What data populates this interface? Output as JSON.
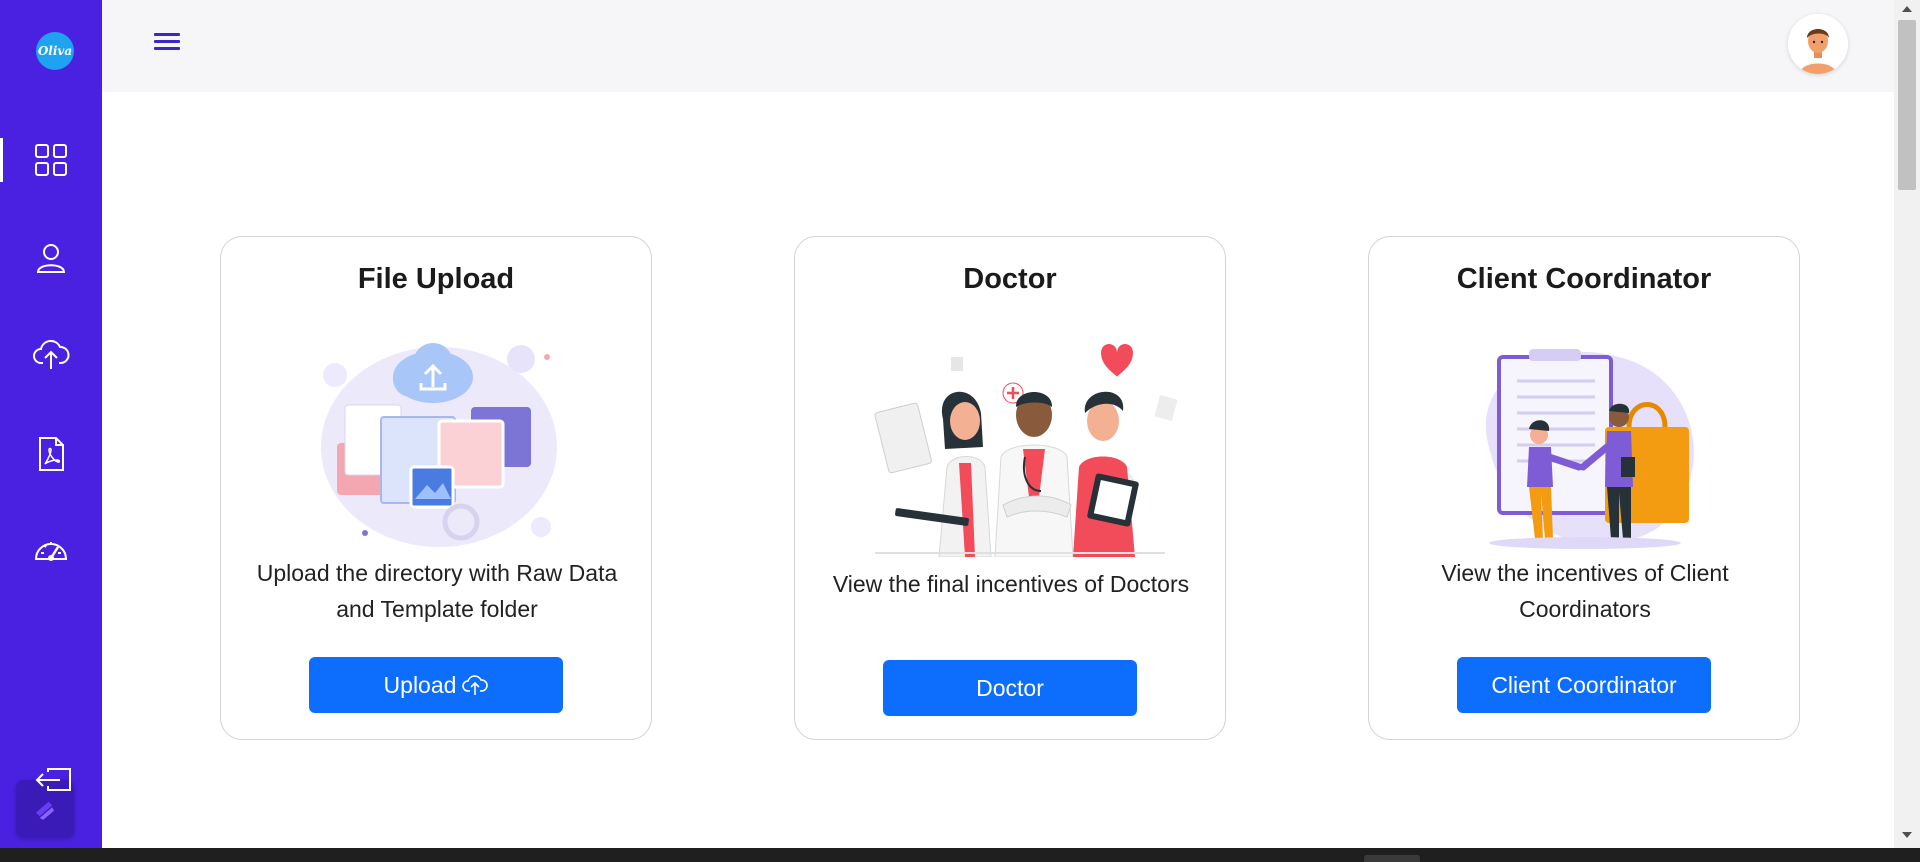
{
  "app": {
    "logo_text": "Oliva"
  },
  "sidebar": {
    "items": [
      {
        "icon": "dashboard-grid-icon",
        "active": true
      },
      {
        "icon": "user-icon",
        "active": false
      },
      {
        "icon": "cloud-upload-icon",
        "active": false
      },
      {
        "icon": "pdf-document-icon",
        "active": false
      },
      {
        "icon": "speedometer-icon",
        "active": false
      }
    ],
    "bottom": {
      "icon": "logout-icon"
    }
  },
  "header": {
    "menu_icon": "hamburger-menu-icon",
    "avatar_icon": "user-avatar-icon"
  },
  "cards": [
    {
      "title": "File Upload",
      "description": "Upload the directory with Raw Data and Template folder",
      "button_label": "Upload",
      "button_icon": "cloud-upload-icon",
      "illustration": "folders-cloud-upload-illustration"
    },
    {
      "title": "Doctor",
      "description": "View the final incentives of Doctors",
      "button_label": "Doctor",
      "illustration": "doctors-team-illustration"
    },
    {
      "title": "Client Coordinator",
      "description": "View the incentives of Client Coordinators",
      "button_label": "Client Coordinator",
      "illustration": "handshake-clipboard-illustration"
    }
  ],
  "colors": {
    "sidebar": "#4a21e0",
    "header": "#f6f6f9",
    "button": "#0d6efd",
    "logo": "#1fa2f2"
  }
}
